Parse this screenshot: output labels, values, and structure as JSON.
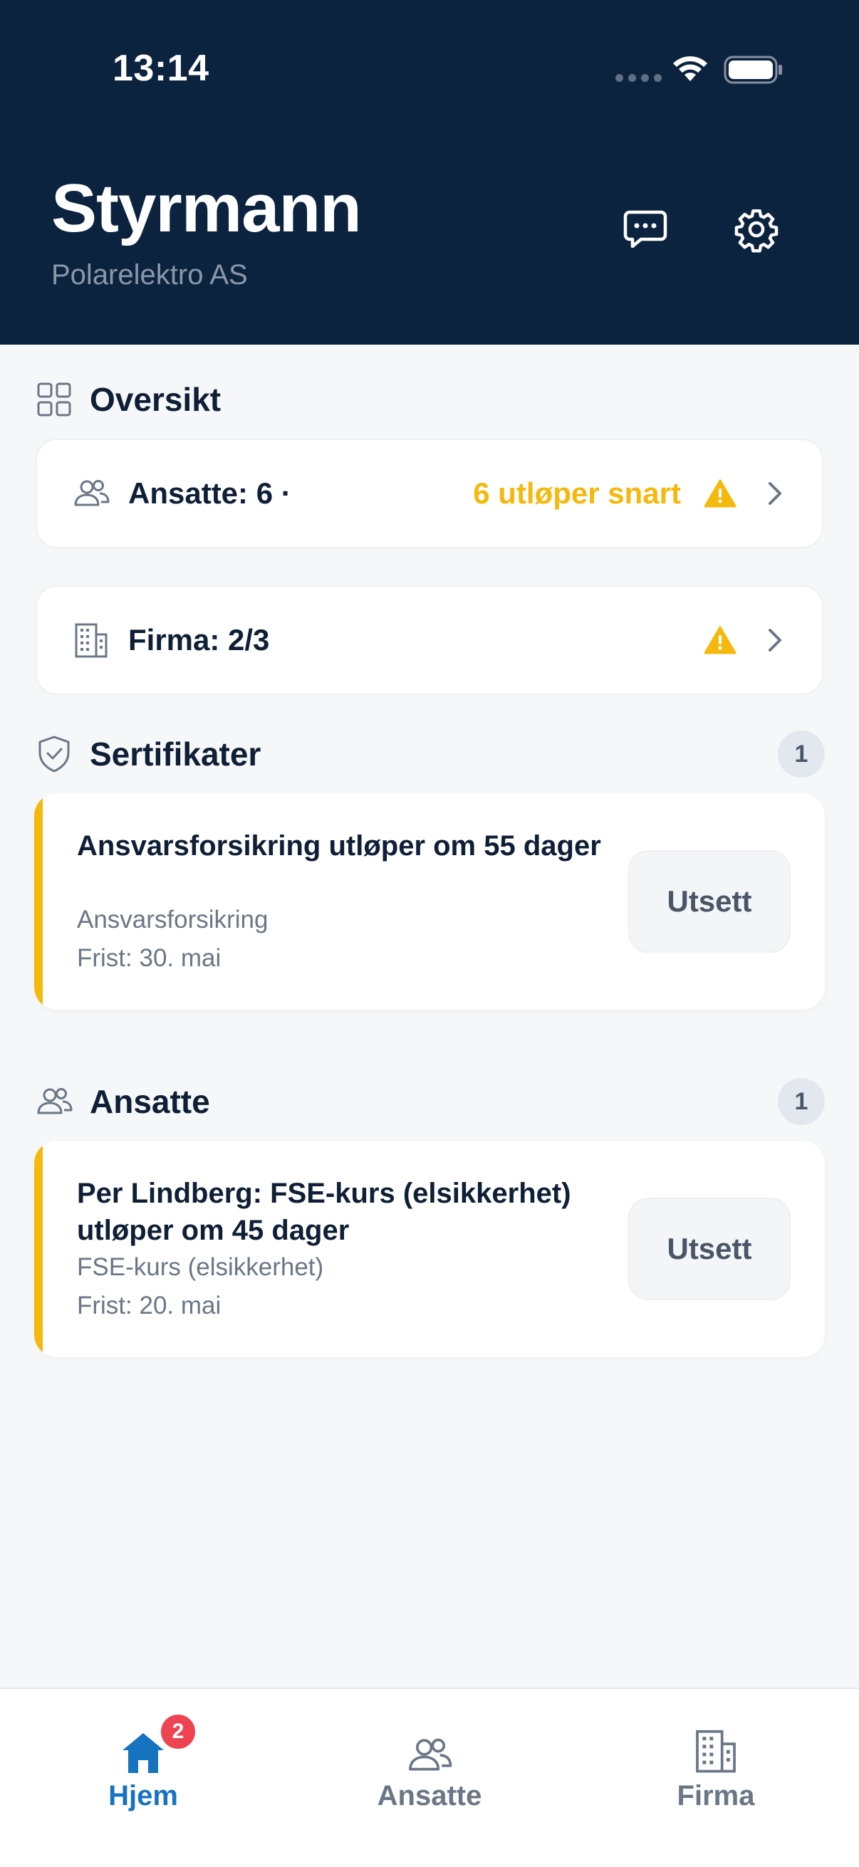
{
  "status_bar": {
    "time": "13:14"
  },
  "header": {
    "title": "Styrmann",
    "subtitle": "Polarelektro AS",
    "chat_icon": "chat-bubble-icon",
    "settings_icon": "gear-icon"
  },
  "overview": {
    "heading": "Oversikt",
    "rows": [
      {
        "label": "Ansatte: 6 ·",
        "warning": "6 utløper snart",
        "icon": "people-icon"
      },
      {
        "label": "Firma: 2/3",
        "warning": "",
        "icon": "building-icon"
      }
    ]
  },
  "certificates": {
    "heading": "Sertifikater",
    "count": "1",
    "items": [
      {
        "title": "Ansvarsforsikring utløper om 55 dager",
        "type": "Ansvarsforsikring",
        "deadline": "Frist: 30. mai",
        "action": "Utsett"
      }
    ]
  },
  "employees": {
    "heading": "Ansatte",
    "count": "1",
    "items": [
      {
        "title": "Per Lindberg: FSE-kurs (elsikkerhet) utløper om 45 dager",
        "type": "FSE-kurs (elsikkerhet)",
        "deadline": "Frist: 20. mai",
        "action": "Utsett"
      }
    ]
  },
  "tabbar": {
    "tabs": [
      {
        "label": "Hjem",
        "icon": "home-icon",
        "badge": "2",
        "active": true
      },
      {
        "label": "Ansatte",
        "icon": "people-icon",
        "active": false
      },
      {
        "label": "Firma",
        "icon": "building-icon",
        "active": false
      }
    ]
  },
  "colors": {
    "header_bg": "#0C2340",
    "accent_warning": "#F5B80C",
    "active_tab": "#1673BF",
    "badge_red": "#EE4452"
  }
}
